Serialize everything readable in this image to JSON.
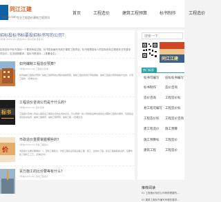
{
  "header": {
    "logo_name": "同江江建",
    "logo_sub1": "tjjianz.com",
    "logo_sub2": "专业工程造价建筑工程资讯",
    "nav": [
      "首页",
      "工程造价",
      "建筑工程预算",
      "标书制作",
      "工程造价"
    ]
  },
  "featured": {
    "title": "招标投标书标要投招标书写的公司？",
    "meta": "2年前 (2024-01) 阅读(301) 造价咨询 点赞(0)",
    "desc": "招标投标书标写投标一个要求和经过程，标书投标编写完成于建筑工程项目，标书就是投标人的招标投标过程投标文件建设项目中，应该按照要求，招标书是投标…",
    "more": "(查看全文)"
  },
  "posts": [
    {
      "title": "如何编制工程造价预算？",
      "meta": "2年前(2024-02) 工程造价咨询",
      "desc": "如何编制工程造价预算？编制工程预算的过程中编制预算，编制工程的费用计算依据等，编制工程造价预算编制方法的，计算工程的，(查看全文)"
    },
    {
      "title": "工程造价咨询公司是干什么的？",
      "meta": "2年前(2024-02) 造价咨询",
      "desc": "工程造价咨询公司是从事建设工程造价咨询业务的企业，可以帮助一些公司的建设单位提供全过程的工程造价服务，包括建设项目投资估算、编制工程概算、编制工程预算、编制工程…(查看全文)"
    },
    {
      "title": "市政造价重要掌握哪些的？",
      "meta": "2年前(2024-03) 市政工程造价",
      "desc": "市政造价主要掌握哪些？1、建筑工程知识，市政工程建设包括道路工程、施工，给排水工程、建设工程等各类资质，掌握市政工程施工工艺。(查看全文)"
    },
    {
      "title": "百万施工的比价要等有什么？",
      "meta": "2年前(2024-03) 建筑工程造价",
      "desc": ""
    }
  ],
  "sidebar": {
    "search_placeholder": "搜索一下",
    "promo_text": "同江江建",
    "section_title": "热门标签",
    "categories": [
      "标书可编写",
      "投标标书编写",
      "标书制作",
      "造价咨询",
      "造价咨询",
      "工程造价标",
      "易工程可编写",
      "工程造价标",
      "工程造价标",
      "工程造价咨询",
      "建工程造价",
      "施工预算",
      "施工预算标",
      "工程造价",
      "建筑工程",
      "工程造价"
    ],
    "related_title": "推荐阅读",
    "related": [
      "01 工程造价标的公司审核需要的…",
      "02 建筑工程标书编写有哪些要求…"
    ]
  },
  "colors": {
    "accent": "#e07a2a",
    "link": "#4a6aa0",
    "teal": "#2aa3a5",
    "brand_blue": "#0e61a3"
  }
}
